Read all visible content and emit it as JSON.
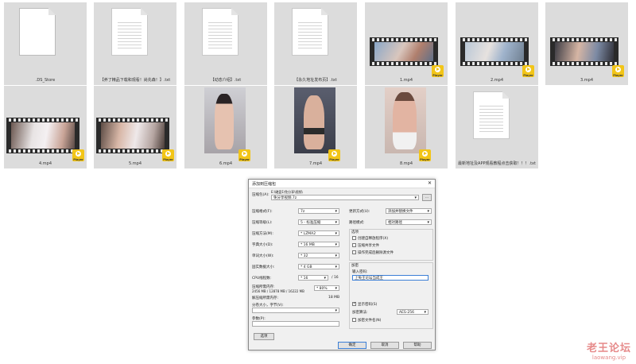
{
  "files": [
    {
      "name": ".DS_Store"
    },
    {
      "name": "【养了精品下载和观看！尚先森！】.txt"
    },
    {
      "name": "【动态介绍】.txt"
    },
    {
      "name": "【永久地址发布页】.txt"
    },
    {
      "name": "1.mp4"
    },
    {
      "name": "2.mp4"
    },
    {
      "name": "3.mp4"
    },
    {
      "name": "4.mp4"
    },
    {
      "name": "5.mp4"
    },
    {
      "name": "6.mp4"
    },
    {
      "name": "7.mp4"
    },
    {
      "name": "8.mp4"
    },
    {
      "name": "最新地址及APP观看教程点击获取！！！.txt"
    }
  ],
  "player_badge": "Player",
  "dialog": {
    "title": "添加到压缩包",
    "archive_label": "压缩包(A):",
    "archive_path_top": "E:\\硬盘1\\免分享\\视频\\",
    "archive_path": "免分享视频.7z",
    "browse": "...",
    "fields": [
      {
        "label": "压缩格式(F):",
        "value": "7z"
      },
      {
        "label": "压缩等级(L):",
        "value": "5 - 标准压缩"
      },
      {
        "label": "压缩方法(M):",
        "value": "* LZMA2"
      },
      {
        "label": "字典大小(D):",
        "value": "* 16 MB"
      },
      {
        "label": "单词大小(W):",
        "value": "* 32"
      },
      {
        "label": "固实数据大小:",
        "value": "* 4 GB"
      },
      {
        "label": "CPU线程数:",
        "value": "* 16"
      }
    ],
    "cpu_total": "/ 16",
    "mem_usage_label": "压缩所需内存:",
    "mem_usage_value": "2456 MB / 12878 MB / 16222 MB",
    "mem_percent": "* 80%",
    "decomp_mem_label": "解压缩所需内存:",
    "decomp_mem_value": "18 MB",
    "split_label": "分卷大小，字节(V):",
    "params_label": "参数(P):",
    "options_button": "选项",
    "update_label": "更新方式(U):",
    "update_value": "添加并替换文件",
    "path_label": "路径模式:",
    "path_value": "相对路径",
    "options_group": "选项",
    "opt1": "创建自释放程序(X)",
    "opt2": "压缩共享文件",
    "opt3": "操作完成后删除源文件",
    "enc_group": "加密",
    "pwd_label": "输入密码:",
    "pwd_value": "上免王论坛当成王",
    "show_pwd": "显示密码(S)",
    "enc_method_label": "加密算法:",
    "enc_method_value": "AES-256",
    "enc_names": "加密文件名(N)",
    "ok": "确定",
    "cancel": "取消",
    "help": "帮助"
  },
  "watermark": {
    "cn": "老王论坛",
    "url": "laowang.vip"
  },
  "colors": {
    "tile_bg": "#dcdcdc",
    "badge": "#f2c518",
    "watermark": "#e68a8a"
  }
}
